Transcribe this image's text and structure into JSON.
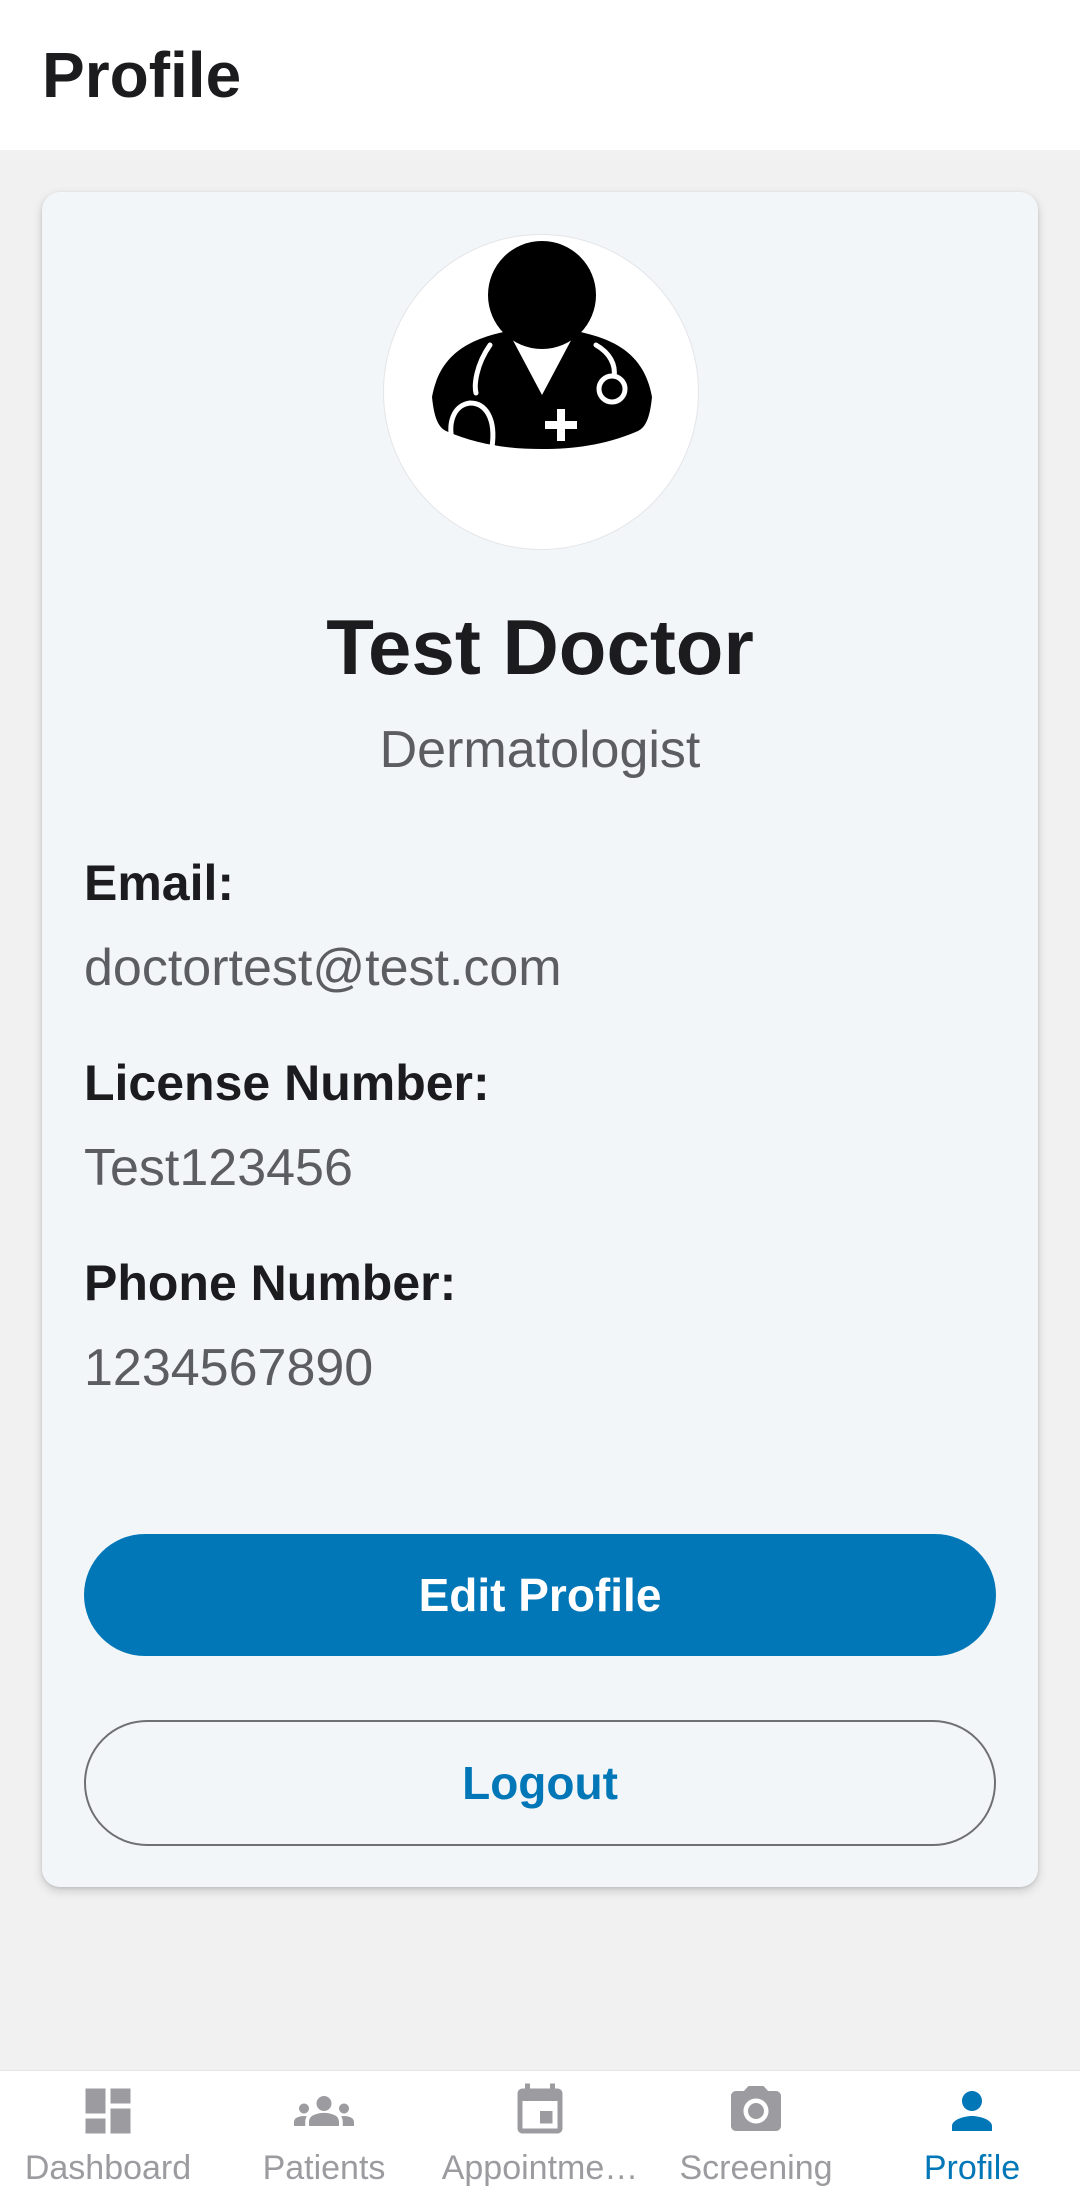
{
  "header": {
    "title": "Profile"
  },
  "profile": {
    "name": "Test Doctor",
    "specialty": "Dermatologist",
    "avatar_icon": "doctor-avatar-icon"
  },
  "fields": {
    "email": {
      "label": "Email:",
      "value": "doctortest@test.com"
    },
    "license": {
      "label": "License Number:",
      "value": "Test123456"
    },
    "phone": {
      "label": "Phone Number:",
      "value": "1234567890"
    }
  },
  "actions": {
    "edit_label": "Edit Profile",
    "logout_label": "Logout"
  },
  "tabbar": {
    "items": [
      {
        "label": "Dashboard",
        "icon": "dashboard-icon",
        "active": false
      },
      {
        "label": "Patients",
        "icon": "patients-icon",
        "active": false
      },
      {
        "label": "Appointme…",
        "icon": "calendar-icon",
        "active": false
      },
      {
        "label": "Screening",
        "icon": "camera-icon",
        "active": false
      },
      {
        "label": "Profile",
        "icon": "person-icon",
        "active": true
      }
    ]
  },
  "colors": {
    "accent": "#0177b7",
    "background": "#f1f1f2",
    "card": "#f3f6f9",
    "inactive_tab": "#9c9ca0"
  }
}
